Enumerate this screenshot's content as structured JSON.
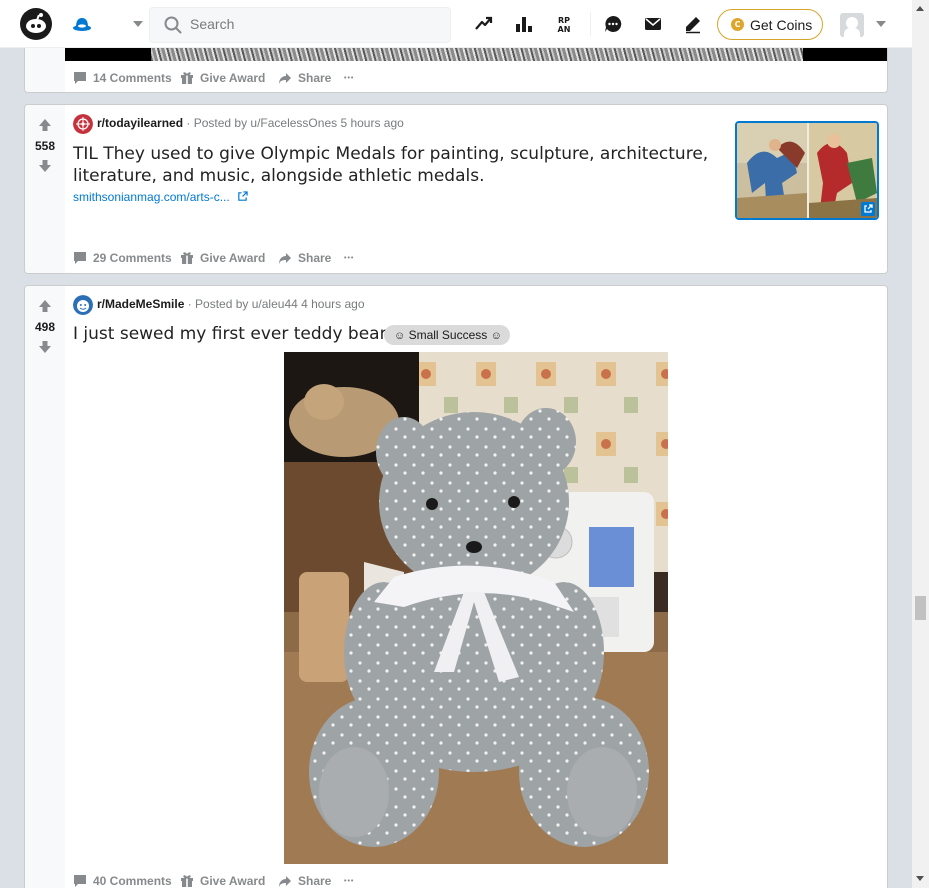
{
  "header": {
    "search_placeholder": "Search",
    "get_coins_label": "Get Coins",
    "coin_glyph": "C"
  },
  "posts": [
    {
      "id": "p0",
      "actions": {
        "comments": "14 Comments",
        "award": "Give Award",
        "share": "Share",
        "more": "•••"
      }
    },
    {
      "id": "p1",
      "votes": "558",
      "subreddit": "r/todayilearned",
      "posted_by": "· Posted by u/FacelessOnes 5 hours ago",
      "title": "TIL They used to give Olympic Medals for painting, sculpture, architecture, literature, and music, alongside athletic medals.",
      "link_text": "smithsonianmag.com/arts-c...",
      "actions": {
        "comments": "29 Comments",
        "award": "Give Award",
        "share": "Share",
        "more": "•••"
      }
    },
    {
      "id": "p2",
      "votes": "498",
      "subreddit": "r/MadeMeSmile",
      "posted_by": "· Posted by u/aleu44 4 hours ago",
      "title": "I just sewed my first ever teddy bear!",
      "flair": "Small Success",
      "actions": {
        "comments": "40 Comments",
        "award": "Give Award",
        "share": "Share",
        "more": "•••"
      }
    }
  ],
  "colors": {
    "upvote_gray": "#878a8c",
    "link_blue": "#0079d3",
    "coin_gold": "#e0a62c",
    "til_red": "#c6323c",
    "page_bg": "#dae0e6"
  }
}
